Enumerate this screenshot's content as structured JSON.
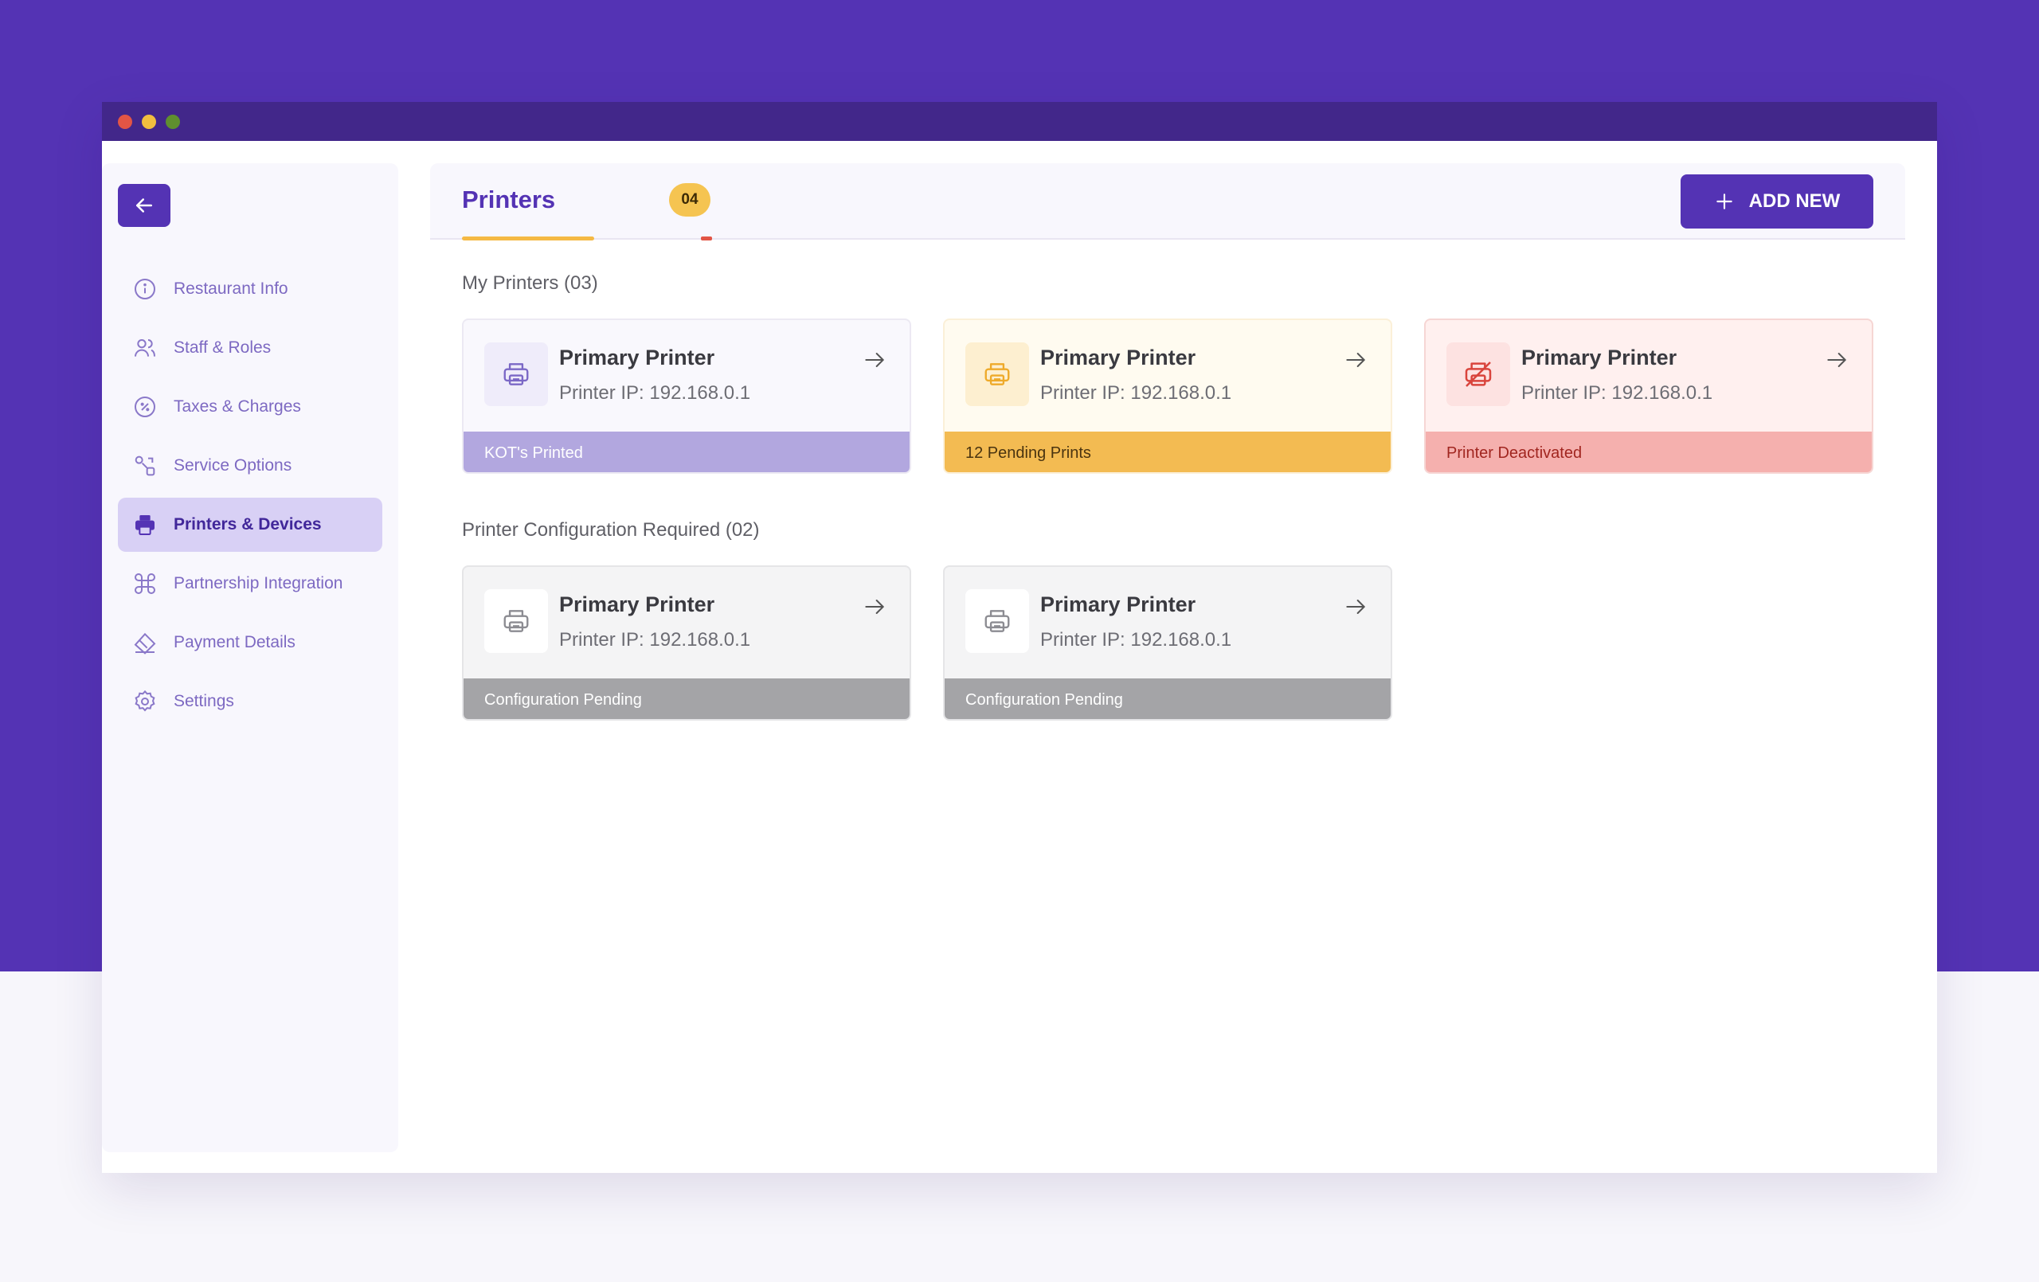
{
  "sidebar": {
    "items": [
      {
        "label": "Restaurant Info",
        "icon": "info-icon",
        "active": false
      },
      {
        "label": "Staff & Roles",
        "icon": "users-icon",
        "active": false
      },
      {
        "label": "Taxes & Charges",
        "icon": "percent-icon",
        "active": false
      },
      {
        "label": "Service Options",
        "icon": "shapes-icon",
        "active": false
      },
      {
        "label": "Printers & Devices",
        "icon": "printer-icon",
        "active": true
      },
      {
        "label": "Partnership Integration",
        "icon": "command-icon",
        "active": false
      },
      {
        "label": "Payment Details",
        "icon": "card-icon",
        "active": false
      },
      {
        "label": "Settings",
        "icon": "gear-icon",
        "active": false
      }
    ]
  },
  "header": {
    "title": "Printers",
    "count": "04",
    "add_button": "ADD NEW"
  },
  "sections": {
    "my_printers": {
      "title": "My Printers (03)",
      "cards": [
        {
          "title": "Primary Printer",
          "ip": "Printer IP: 192.168.0.1",
          "status": "KOT's Printed",
          "variant": "purple"
        },
        {
          "title": "Primary Printer",
          "ip": "Printer IP: 192.168.0.1",
          "status": "12 Pending Prints",
          "variant": "yellow"
        },
        {
          "title": "Primary Printer",
          "ip": "Printer IP: 192.168.0.1",
          "status": "Printer Deactivated",
          "variant": "red"
        }
      ]
    },
    "config_required": {
      "title": "Printer Configuration Required (02)",
      "cards": [
        {
          "title": "Primary Printer",
          "ip": "Printer IP: 192.168.0.1",
          "status": "Configuration Pending",
          "variant": "grey"
        },
        {
          "title": "Primary Printer",
          "ip": "Printer IP: 192.168.0.1",
          "status": "Configuration Pending",
          "variant": "grey"
        }
      ]
    }
  },
  "colors": {
    "brand": "#5433b4",
    "titlebar": "#42278a",
    "badge": "#f5c451",
    "status_printed": "#b2a7df",
    "status_pending": "#f3bb52",
    "status_deactivated": "#f5b0ae",
    "status_config": "#a4a4a7"
  }
}
